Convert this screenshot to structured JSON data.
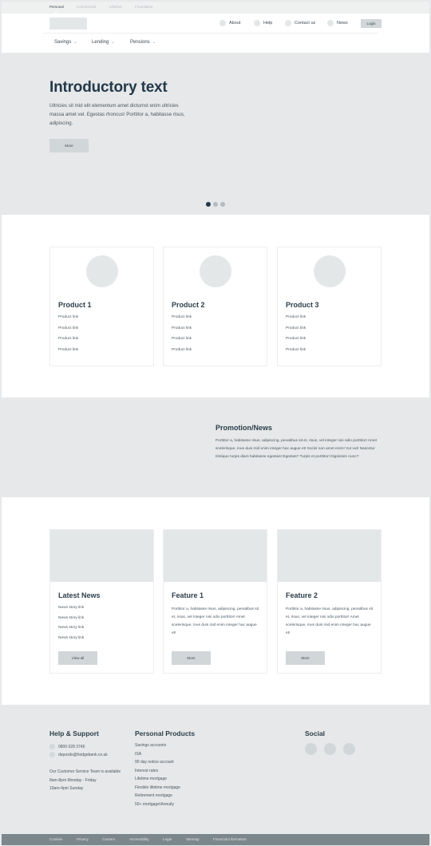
{
  "segments": [
    {
      "label": "Personal",
      "active": true
    },
    {
      "label": "Commercial",
      "active": false
    },
    {
      "label": "Lifetime",
      "active": false
    },
    {
      "label": "Foundation",
      "active": false
    }
  ],
  "header": {
    "utility_links": [
      {
        "label": "About",
        "icon": "circle-icon"
      },
      {
        "label": "Help",
        "icon": "circle-icon"
      },
      {
        "label": "Contact us",
        "icon": "circle-icon"
      },
      {
        "label": "News",
        "icon": "circle-icon"
      }
    ],
    "login_label": "Login",
    "main_nav": [
      {
        "label": "Savings"
      },
      {
        "label": "Lending"
      },
      {
        "label": "Pensions"
      }
    ],
    "chevron": "⌄"
  },
  "hero": {
    "title": "Introductory text",
    "body": "Ultricies sit mid elit elementum amet dictumst enim ultricies massa amet vel. Egestas rhoncus! Porttitor a, habitasse risus, adipiscing.",
    "button_label": "More",
    "carousel": {
      "total": 3,
      "active": 1
    }
  },
  "products": [
    {
      "title": "Product 1",
      "links": [
        "Product link",
        "Product link",
        "Product link",
        "Product link"
      ]
    },
    {
      "title": "Product 2",
      "links": [
        "Product link",
        "Product link",
        "Product link",
        "Product link"
      ]
    },
    {
      "title": "Product 3",
      "links": [
        "Product link",
        "Product link",
        "Product link",
        "Product link"
      ]
    }
  ],
  "promo": {
    "title": "Promotion/News",
    "body": "Porttitor a, habitasse risus, adipiscing, penatibus sit et, risus, vel integer nisi odio porttitor! Amet scelerisque, mus duis mid enim integer hac augue et! Sociis non amet enim! Vut vut! Nascetur tristique turpis diam habitasse egestas! Egestas? Turpis et porttitor! Dignissim nunc?"
  },
  "features": {
    "latest_news": {
      "title": "Latest News",
      "links": [
        "News story link",
        "News story link",
        "News story link",
        "News story link"
      ],
      "button_label": "View all"
    },
    "feature1": {
      "title": "Feature 1",
      "body": "Porttitor a, habitasse risus, adipiscing, penatibus sit et, risus, vel integer nisi odio porttitor! Amet scelerisque, mus duis mid enim integer hac augue et!",
      "button_label": "More"
    },
    "feature2": {
      "title": "Feature 2",
      "body": "Porttitor a, habitasse risus, adipiscing, penatibus sit et, risus, vel integer nisi odio porttitor! Amet scelerisque, mus duis mid enim integer hac augue et!",
      "button_label": "More"
    }
  },
  "footer": {
    "help": {
      "title": "Help & Support",
      "phone": "0800 028 3746",
      "email": "deposits@hodgebank.co.uk",
      "hours": [
        "Our Customer Service Team is available",
        "8am-8pm Monday - Friday",
        "10am-4pm Sunday"
      ]
    },
    "personal_products": {
      "title": "Personal Products",
      "links": [
        "Savings accounts",
        "ISA",
        "90 day notice account",
        "Interest rates",
        "Lifetime mortgage",
        "Flexible lifetime mortgage",
        "Retirement mortgage",
        "55+ mortgage\\Annuity"
      ]
    },
    "social": {
      "title": "Social",
      "count": 3
    },
    "bottom_links": [
      "Cookies",
      "Privacy",
      "Careers",
      "Accessibility",
      "Legal",
      "Sitemap",
      "Financial information"
    ]
  }
}
